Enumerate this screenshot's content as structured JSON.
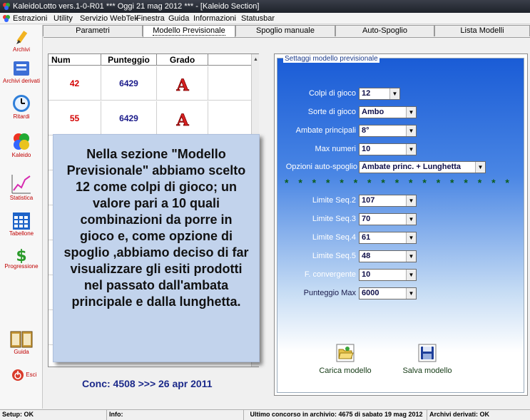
{
  "window": {
    "title": "KaleidoLotto vers.1-0-R01  *** Oggi 21 mag 2012  *** - [Kaleido Section]"
  },
  "menu": [
    "Estrazioni",
    "Utility",
    "Servizio WebTek",
    "Finestra",
    "Guida",
    "Informazioni",
    "Statusbar"
  ],
  "tabs": [
    "Parametri",
    "Modello Previsionale",
    "Spoglio manuale",
    "Auto-Spoglio",
    "Lista Modelli"
  ],
  "sidebar": [
    "Archivi",
    "Archivi derivati",
    "Ritardi",
    "Kaleido",
    "Statistica",
    "Tabellone",
    "Progressione",
    "Guida",
    "Esci"
  ],
  "grid": {
    "headers": [
      "Num",
      "Punteggio",
      "Grado"
    ],
    "rows": [
      {
        "num": "42",
        "punteggio": "6429",
        "grado": "A-icon"
      },
      {
        "num": "55",
        "punteggio": "6429",
        "grado": "A-icon"
      }
    ]
  },
  "conc_line": "Conc: 4508 >>> 26 apr 2011",
  "settings": {
    "title": "Settaggi modello previsionale",
    "fields": [
      {
        "label": "Colpi di gioco",
        "value": "12"
      },
      {
        "label": "Sorte di gioco",
        "value": "Ambo"
      },
      {
        "label": "Ambate principali",
        "value": "8°"
      },
      {
        "label": "Max numeri",
        "value": "10"
      },
      {
        "label": "Opzioni auto-spoglio",
        "value": "Ambate princ. + Lunghetta"
      }
    ],
    "stars": "* * * * * * * * * * * * * * * * * * * *",
    "limits": [
      {
        "label": "Limite Seq.2",
        "value": "107"
      },
      {
        "label": "Limite Seq.3",
        "value": "70"
      },
      {
        "label": "Limite Seq.4",
        "value": "61"
      },
      {
        "label": "Limite Seq.5",
        "value": "48"
      },
      {
        "label": "F. convergente",
        "value": "10"
      },
      {
        "label": "Punteggio Max",
        "value": "6000"
      }
    ],
    "load_label": "Carica modello",
    "save_label": "Salva modello"
  },
  "overlay_text": "Nella sezione \"Modello Previsionale\" abbiamo scelto 12 come colpi di gioco; un valore pari a 10 quali combinazioni da porre in gioco e, come opzione di spoglio ,abbiamo deciso di far visualizzare gli esiti prodotti nel passato dall'ambata principale e dalla lunghetta.",
  "status": {
    "setup": "Setup: OK",
    "info": "Info:",
    "ultimo": "Ultimo concorso in archivio: 4675 di sabato 19 mag 2012",
    "derivati": "Archivi derivati: OK"
  },
  "colors": {
    "accent_blue": "#1a5cd6",
    "num_red": "#d40000",
    "score_blue": "#1a1a8a"
  }
}
